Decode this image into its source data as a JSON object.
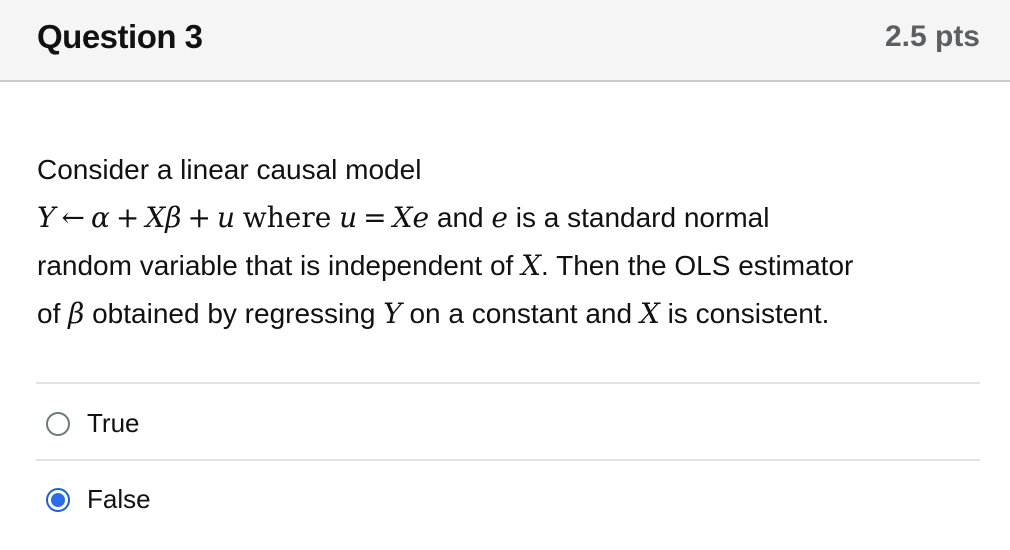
{
  "question": {
    "title": "Question 3",
    "points": "2.5 pts",
    "text": {
      "line1": "Consider a linear causal model",
      "line2": {
        "Y": "Y",
        "arrow": "←",
        "alpha": "α",
        "plus1": "+",
        "X": "X",
        "beta": "β",
        "plus2": "+",
        "u": "u",
        "where": "where",
        "u2": "u",
        "eq": "=",
        "Xe": "Xe",
        "and": "and",
        "e": "e",
        "rest": "is a standard normal"
      },
      "line3": {
        "pre": "random variable that is independent of",
        "X": "X",
        "post": ". Then the OLS estimator"
      },
      "line4": {
        "of": "of",
        "beta": "β",
        "mid": "obtained by regressing",
        "Y": "Y",
        "mid2": "on a constant and",
        "X": "X",
        "post": "is consistent."
      }
    }
  },
  "answers": [
    {
      "label": "True",
      "selected": false
    },
    {
      "label": "False",
      "selected": true
    }
  ],
  "colors": {
    "header_bg": "#f5f5f5",
    "radio_selected": "#2b6de8",
    "text": "#111111",
    "points": "#595f63"
  }
}
